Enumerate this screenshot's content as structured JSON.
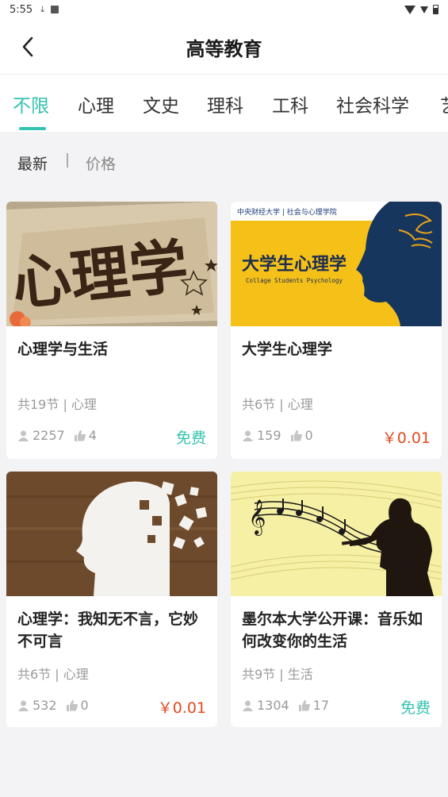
{
  "status_bar": {
    "time": "5:55"
  },
  "header": {
    "title": "高等教育"
  },
  "tabs": [
    {
      "label": "不限"
    },
    {
      "label": "心理"
    },
    {
      "label": "文史"
    },
    {
      "label": "理科"
    },
    {
      "label": "工科"
    },
    {
      "label": "社会科学"
    },
    {
      "label": "艺"
    }
  ],
  "sort": {
    "newest": "最新",
    "price": "价格"
  },
  "thumbs": {
    "c1": "心理学",
    "c2_header": "中央财经大学 | 社会与心理学院",
    "c2_title": "大学生心理学",
    "c2_sub": "Collage Students Psychology"
  },
  "courses": [
    {
      "title": "心理学与生活",
      "meta": "共19节 | 心理",
      "views": "2257",
      "likes": "4",
      "price": "免费"
    },
    {
      "title": "大学生心理学",
      "meta": "共6节 | 心理",
      "views": "159",
      "likes": "0",
      "price": "￥0.01"
    },
    {
      "title": "心理学：我知无不言，它妙不可言",
      "meta": "共6节 | 心理",
      "views": "532",
      "likes": "0",
      "price": "￥0.01"
    },
    {
      "title": "墨尔本大学公开课：音乐如何改变你的生活",
      "meta": "共9节 | 生活",
      "views": "1304",
      "likes": "17",
      "price": "免费"
    }
  ],
  "colors": {
    "accent": "#34c3b0",
    "price": "#e04a1f"
  }
}
